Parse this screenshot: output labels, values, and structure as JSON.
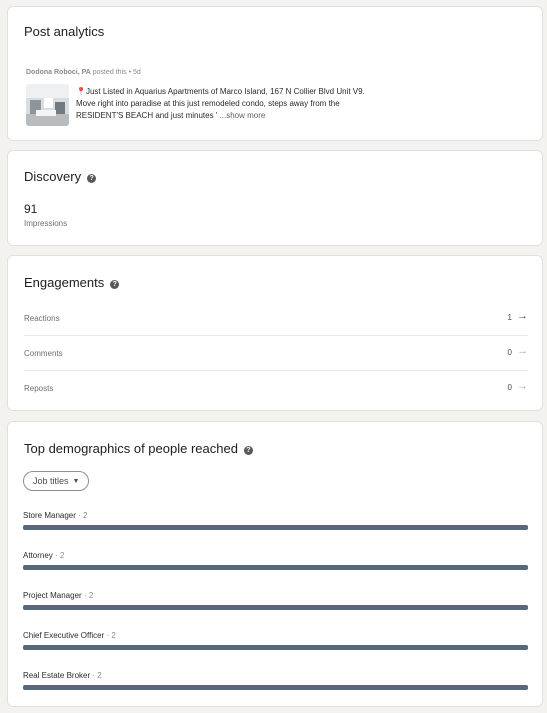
{
  "post_card": {
    "title": "Post analytics",
    "author": "Dodona Roboci, PA",
    "meta": "posted this • 5d",
    "text": "Just Listed in Aquarius Apartments of Marco Island, 167 N Collier Blvd Unit V9. Move right into paradise at this just remodeled condo, steps away from the RESIDENT'S BEACH and just minutes ' ",
    "show_more": "...show more"
  },
  "discovery": {
    "title": "Discovery",
    "impressions_value": "91",
    "impressions_label": "Impressions"
  },
  "engagements": {
    "title": "Engagements",
    "rows": [
      {
        "label": "Reactions",
        "value": "1"
      },
      {
        "label": "Comments",
        "value": "0"
      },
      {
        "label": "Reposts",
        "value": "0"
      }
    ]
  },
  "demographics": {
    "title": "Top demographics of people reached",
    "filter": "Job titles",
    "items": [
      {
        "name": "Store Manager",
        "count": "· 2",
        "share": 1.0
      },
      {
        "name": "Attorney",
        "count": "· 2",
        "share": 1.0
      },
      {
        "name": "Project Manager",
        "count": "· 2",
        "share": 1.0
      },
      {
        "name": "Chief Executive Officer",
        "count": "· 2",
        "share": 1.0
      },
      {
        "name": "Real Estate Broker",
        "count": "· 2",
        "share": 1.0
      }
    ]
  },
  "colors": {
    "bar": "#56687a",
    "background": "#f3f2ef"
  }
}
